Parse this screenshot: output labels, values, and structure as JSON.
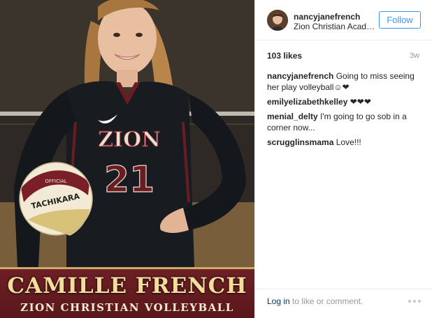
{
  "photo": {
    "banner_name": "CAMILLE FRENCH",
    "banner_team": "ZION CHRISTIAN VOLLEYBALL",
    "jersey_text": "ZION",
    "jersey_number": "21",
    "ball_text": "TACHIKARA",
    "ball_small": "OFFICIAL"
  },
  "header": {
    "username": "nancyjanefrench",
    "location": "Zion Christian Academy",
    "follow_label": "Follow"
  },
  "stats": {
    "likes": "103 likes",
    "time": "3w"
  },
  "comments": [
    {
      "author": "nancyjanefrench",
      "text": "Going to miss seeing her play volleyball☺❤"
    },
    {
      "author": "emilyelizabethkelley",
      "text": "❤❤❤"
    },
    {
      "author": "menial_delty",
      "text": "I'm going to go sob in a corner now..."
    },
    {
      "author": "scrugglinsmama",
      "text": "Love!!!"
    }
  ],
  "footer": {
    "login_label": "Log in",
    "login_suffix": " to like or comment."
  },
  "icons": {
    "more": "more-options-icon"
  },
  "colors": {
    "accent": "#3897f0",
    "link": "#003569",
    "banner": "#6d1f24",
    "banner_text": "#f3dd9c"
  }
}
